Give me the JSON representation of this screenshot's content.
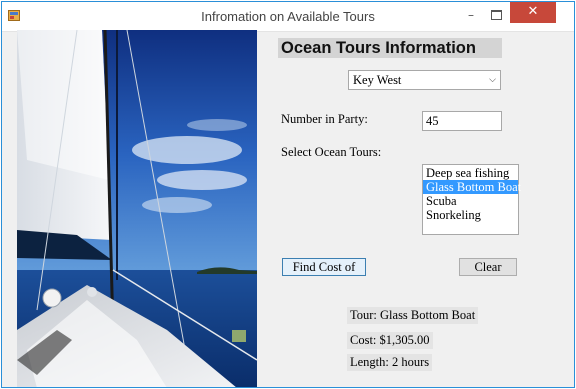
{
  "window": {
    "title": "Infromation on Available Tours",
    "minimize_glyph": "–",
    "close_glyph": "✕",
    "accent_color": "#c7483a"
  },
  "form": {
    "heading": "Ocean Tours Information",
    "location_select": {
      "selected": "Key West",
      "arrow_icon": "chevron-down-icon"
    },
    "party_label": "Number in Party:",
    "party_value": "45",
    "tours_label": "Select Ocean Tours:",
    "tours": [
      {
        "label": "Deep sea fishing",
        "selected": false
      },
      {
        "label": "Glass Bottom Boat",
        "selected": true
      },
      {
        "label": "Scuba",
        "selected": false
      },
      {
        "label": "Snorkeling",
        "selected": false
      }
    ],
    "selection_color": "#3399ff",
    "find_button": "Find Cost of",
    "clear_button": "Clear"
  },
  "results": {
    "tour": "Tour: Glass Bottom Boat",
    "cost": "Cost: $1,305.00",
    "length": "Length: 2 hours"
  }
}
